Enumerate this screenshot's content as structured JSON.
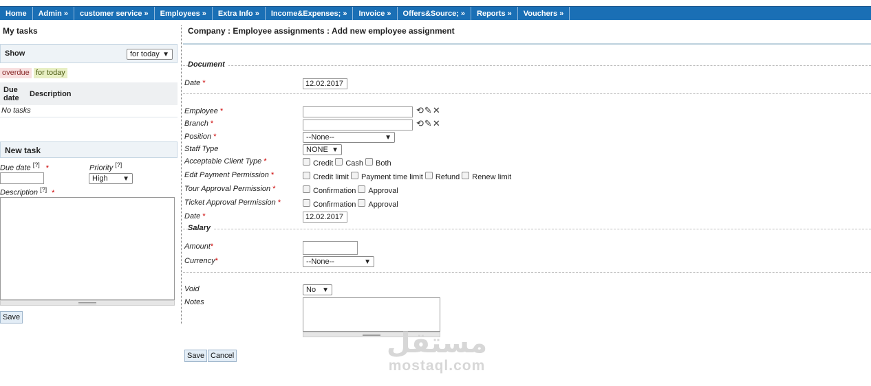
{
  "nav": {
    "items": [
      {
        "label": "Home"
      },
      {
        "label": "Admin »"
      },
      {
        "label": "customer service »"
      },
      {
        "label": "Employees »"
      },
      {
        "label": "Extra Info »"
      },
      {
        "label": "Income&Expenses; »"
      },
      {
        "label": "Invoice »"
      },
      {
        "label": "Offers&Source; »"
      },
      {
        "label": "Reports »"
      },
      {
        "label": "Vouchers »"
      }
    ]
  },
  "sidebar": {
    "title": "My tasks",
    "show_label": "Show",
    "show_value": "for today",
    "badge_overdue": "overdue",
    "badge_today": "for today",
    "col_due": "Due date",
    "col_desc": "Description",
    "no_tasks": "No tasks",
    "new_task_title": "New task",
    "due_label": "Due date",
    "priority_label": "Priority",
    "priority_value": "High",
    "description_label": "Description",
    "hint_mark": "[?]",
    "required_mark": "*",
    "save_label": "Save"
  },
  "main": {
    "breadcrumb": "Company : Employee assignments : Add new employee assignment",
    "section_document": "Document",
    "section_salary": "Salary",
    "date_label": "Date",
    "date_value": "12.02.2017",
    "employee_label": "Employee",
    "branch_label": "Branch",
    "position_label": "Position",
    "position_value": "--None--",
    "staff_type_label": "Staff Type",
    "staff_type_value": "NONE",
    "client_type_label": "Acceptable Client Type",
    "client_type_options": [
      "Credit",
      "Cash",
      "Both"
    ],
    "payment_perm_label": "Edit Payment Permission",
    "payment_perm_options": [
      "Credit limit",
      "Payment time limit",
      "Refund",
      "Renew limit"
    ],
    "tour_perm_label": "Tour Approval Permission",
    "tour_perm_options": [
      "Confirmation",
      "Approval"
    ],
    "ticket_perm_label": "Ticket Approval Permission",
    "ticket_perm_options": [
      "Confirmation",
      "Approval"
    ],
    "date2_label": "Date",
    "date2_value": "12.02.2017",
    "amount_label": "Amount",
    "currency_label": "Currency",
    "currency_value": "--None--",
    "void_label": "Void",
    "void_value": "No",
    "notes_label": "Notes",
    "save_label": "Save",
    "cancel_label": "Cancel",
    "required_mark": "*"
  },
  "watermark": {
    "arabic": "مستقل",
    "latin": "mostaql.com"
  },
  "icons": {
    "refresh": "refresh-icon",
    "edit": "pencil-icon",
    "clear": "close-icon"
  },
  "colors": {
    "nav_bg": "#1a6fb5",
    "required": "#cc0000",
    "overdue_bg": "#f8e0e0",
    "today_bg": "#e8efc4"
  }
}
